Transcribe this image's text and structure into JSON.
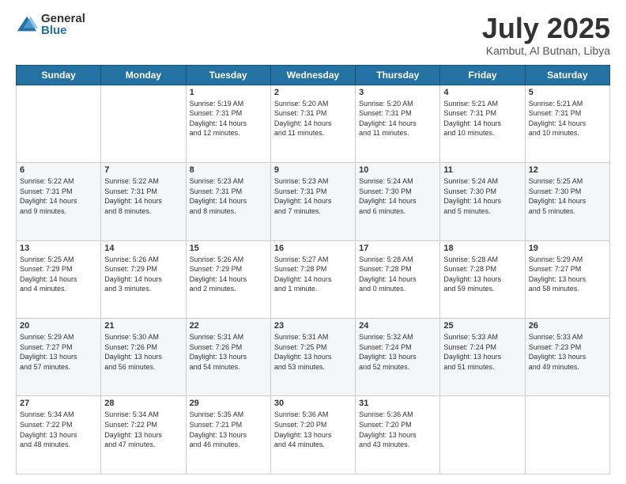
{
  "logo": {
    "general": "General",
    "blue": "Blue"
  },
  "title": "July 2025",
  "location": "Kambut, Al Butnan, Libya",
  "days_of_week": [
    "Sunday",
    "Monday",
    "Tuesday",
    "Wednesday",
    "Thursday",
    "Friday",
    "Saturday"
  ],
  "weeks": [
    [
      {
        "day": "",
        "info": ""
      },
      {
        "day": "",
        "info": ""
      },
      {
        "day": "1",
        "info": "Sunrise: 5:19 AM\nSunset: 7:31 PM\nDaylight: 14 hours\nand 12 minutes."
      },
      {
        "day": "2",
        "info": "Sunrise: 5:20 AM\nSunset: 7:31 PM\nDaylight: 14 hours\nand 11 minutes."
      },
      {
        "day": "3",
        "info": "Sunrise: 5:20 AM\nSunset: 7:31 PM\nDaylight: 14 hours\nand 11 minutes."
      },
      {
        "day": "4",
        "info": "Sunrise: 5:21 AM\nSunset: 7:31 PM\nDaylight: 14 hours\nand 10 minutes."
      },
      {
        "day": "5",
        "info": "Sunrise: 5:21 AM\nSunset: 7:31 PM\nDaylight: 14 hours\nand 10 minutes."
      }
    ],
    [
      {
        "day": "6",
        "info": "Sunrise: 5:22 AM\nSunset: 7:31 PM\nDaylight: 14 hours\nand 9 minutes."
      },
      {
        "day": "7",
        "info": "Sunrise: 5:22 AM\nSunset: 7:31 PM\nDaylight: 14 hours\nand 8 minutes."
      },
      {
        "day": "8",
        "info": "Sunrise: 5:23 AM\nSunset: 7:31 PM\nDaylight: 14 hours\nand 8 minutes."
      },
      {
        "day": "9",
        "info": "Sunrise: 5:23 AM\nSunset: 7:31 PM\nDaylight: 14 hours\nand 7 minutes."
      },
      {
        "day": "10",
        "info": "Sunrise: 5:24 AM\nSunset: 7:30 PM\nDaylight: 14 hours\nand 6 minutes."
      },
      {
        "day": "11",
        "info": "Sunrise: 5:24 AM\nSunset: 7:30 PM\nDaylight: 14 hours\nand 5 minutes."
      },
      {
        "day": "12",
        "info": "Sunrise: 5:25 AM\nSunset: 7:30 PM\nDaylight: 14 hours\nand 5 minutes."
      }
    ],
    [
      {
        "day": "13",
        "info": "Sunrise: 5:25 AM\nSunset: 7:29 PM\nDaylight: 14 hours\nand 4 minutes."
      },
      {
        "day": "14",
        "info": "Sunrise: 5:26 AM\nSunset: 7:29 PM\nDaylight: 14 hours\nand 3 minutes."
      },
      {
        "day": "15",
        "info": "Sunrise: 5:26 AM\nSunset: 7:29 PM\nDaylight: 14 hours\nand 2 minutes."
      },
      {
        "day": "16",
        "info": "Sunrise: 5:27 AM\nSunset: 7:28 PM\nDaylight: 14 hours\nand 1 minute."
      },
      {
        "day": "17",
        "info": "Sunrise: 5:28 AM\nSunset: 7:28 PM\nDaylight: 14 hours\nand 0 minutes."
      },
      {
        "day": "18",
        "info": "Sunrise: 5:28 AM\nSunset: 7:28 PM\nDaylight: 13 hours\nand 59 minutes."
      },
      {
        "day": "19",
        "info": "Sunrise: 5:29 AM\nSunset: 7:27 PM\nDaylight: 13 hours\nand 58 minutes."
      }
    ],
    [
      {
        "day": "20",
        "info": "Sunrise: 5:29 AM\nSunset: 7:27 PM\nDaylight: 13 hours\nand 57 minutes."
      },
      {
        "day": "21",
        "info": "Sunrise: 5:30 AM\nSunset: 7:26 PM\nDaylight: 13 hours\nand 56 minutes."
      },
      {
        "day": "22",
        "info": "Sunrise: 5:31 AM\nSunset: 7:26 PM\nDaylight: 13 hours\nand 54 minutes."
      },
      {
        "day": "23",
        "info": "Sunrise: 5:31 AM\nSunset: 7:25 PM\nDaylight: 13 hours\nand 53 minutes."
      },
      {
        "day": "24",
        "info": "Sunrise: 5:32 AM\nSunset: 7:24 PM\nDaylight: 13 hours\nand 52 minutes."
      },
      {
        "day": "25",
        "info": "Sunrise: 5:33 AM\nSunset: 7:24 PM\nDaylight: 13 hours\nand 51 minutes."
      },
      {
        "day": "26",
        "info": "Sunrise: 5:33 AM\nSunset: 7:23 PM\nDaylight: 13 hours\nand 49 minutes."
      }
    ],
    [
      {
        "day": "27",
        "info": "Sunrise: 5:34 AM\nSunset: 7:22 PM\nDaylight: 13 hours\nand 48 minutes."
      },
      {
        "day": "28",
        "info": "Sunrise: 5:34 AM\nSunset: 7:22 PM\nDaylight: 13 hours\nand 47 minutes."
      },
      {
        "day": "29",
        "info": "Sunrise: 5:35 AM\nSunset: 7:21 PM\nDaylight: 13 hours\nand 46 minutes."
      },
      {
        "day": "30",
        "info": "Sunrise: 5:36 AM\nSunset: 7:20 PM\nDaylight: 13 hours\nand 44 minutes."
      },
      {
        "day": "31",
        "info": "Sunrise: 5:36 AM\nSunset: 7:20 PM\nDaylight: 13 hours\nand 43 minutes."
      },
      {
        "day": "",
        "info": ""
      },
      {
        "day": "",
        "info": ""
      }
    ]
  ]
}
